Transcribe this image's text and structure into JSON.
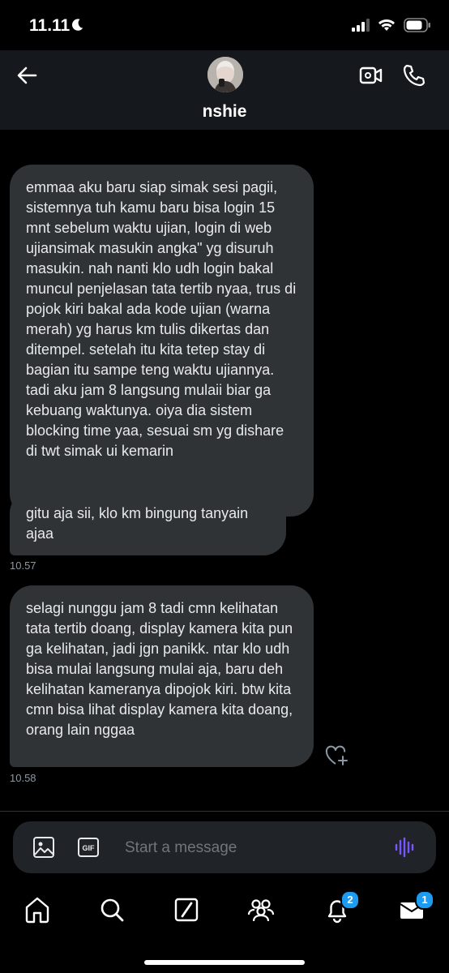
{
  "status_bar": {
    "time": "11.11"
  },
  "header": {
    "contact_name": "nshie"
  },
  "messages": [
    {
      "text": "emmaa aku baru siap simak sesi pagii, sistemnya tuh kamu baru bisa login 15 mnt sebelum waktu ujian, login di web ujiansimak masukin angka\" yg disuruh masukin. nah nanti klo udh login bakal muncul penjelasan tata tertib nyaa, trus di pojok kiri bakal ada kode ujian (warna merah) yg harus km tulis dikertas dan ditempel. setelah itu kita tetep stay di bagian itu sampe teng waktu ujiannya. tadi aku jam 8 langsung mulaii biar ga kebuang waktunya. oiya dia sistem blocking time yaa, sesuai sm yg dishare di twt simak ui kemarin"
    },
    {
      "text": "gitu aja sii, klo km bingung tanyain ajaa",
      "time": "10.57"
    },
    {
      "text": "selagi nunggu jam 8 tadi cmn kelihatan tata tertib doang, display kamera kita pun ga kelihatan, jadi jgn panikk. ntar klo udh bisa mulai langsung mulai aja, baru deh kelihatan kameranya dipojok kiri. btw kita cmn bisa lihat display kamera kita doang, orang lain nggaa",
      "time": "10.58"
    }
  ],
  "composer": {
    "placeholder": "Start a message",
    "gif_label": "GIF"
  },
  "tabbar": {
    "notifications_badge": "2",
    "messages_badge": "1"
  },
  "colors": {
    "accent": "#1d9bf0",
    "voice": "#7856ff",
    "bubble": "#2f3336"
  }
}
